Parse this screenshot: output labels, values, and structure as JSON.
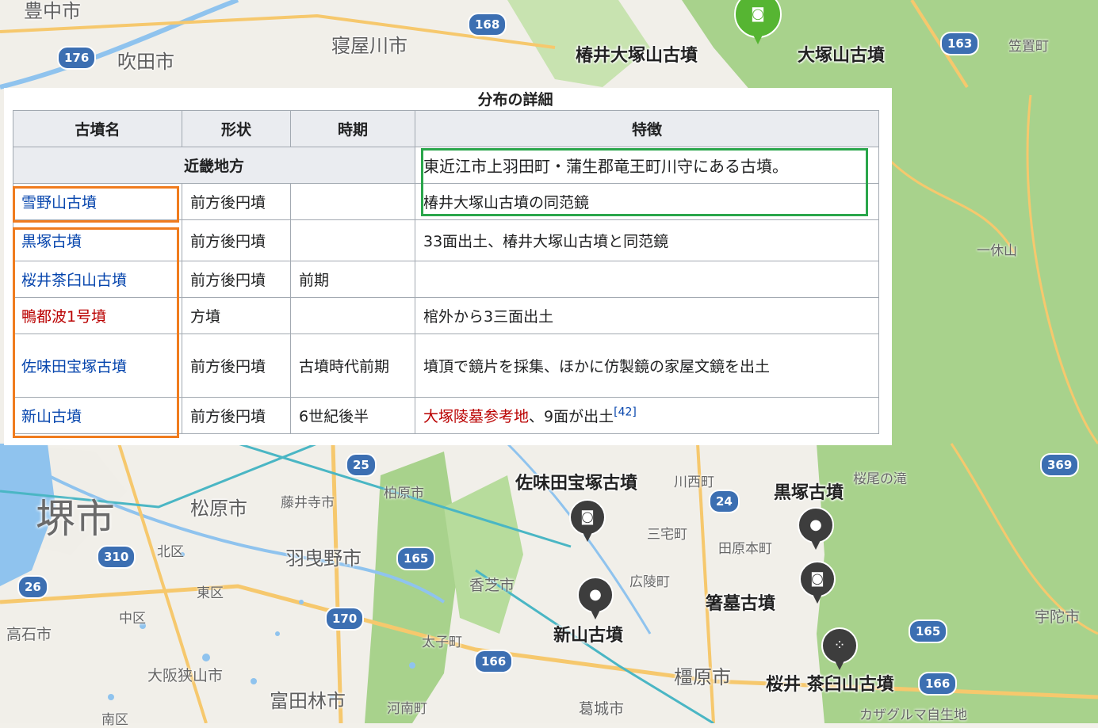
{
  "map": {
    "cities": [
      "吹田市",
      "寝屋川市",
      "松原市",
      "羽曳野市",
      "富田林市",
      "大阪狭山市",
      "橿原市",
      "堺市",
      "宇陀市",
      "香芝市",
      "葛城市",
      "高石市",
      "豊中市"
    ],
    "towns": [
      "笠置町",
      "一休山",
      "柏原市",
      "藤井寺市",
      "北区",
      "東区",
      "中区",
      "南区",
      "広陵町",
      "三宅町",
      "田原本町",
      "川西町",
      "太子町",
      "河南町",
      "桜尾の滝",
      "カザグルマ自生地"
    ],
    "routes": [
      "168",
      "176",
      "163",
      "25",
      "24",
      "369",
      "310",
      "165",
      "26",
      "170",
      "165",
      "166",
      "166"
    ],
    "pois": [
      "椿井大塚山古墳",
      "大塚山古墳",
      "佐味田宝塚古墳",
      "黒塚古墳",
      "箸墓古墳",
      "新山古墳",
      "桜井 茶臼山古墳"
    ],
    "icons": [
      "camera-icon",
      "dot-icon",
      "cluster-icon"
    ]
  },
  "table": {
    "caption": "分布の詳細",
    "headers": [
      "古墳名",
      "形状",
      "時期",
      "特徴"
    ],
    "region": "近畿地方",
    "region_note": "東近江市上羽田町・蒲生郡竜王町川守にある古墳。",
    "rows": [
      {
        "name": "雪野山古墳",
        "link": "blue",
        "shape": "前方後円墳",
        "period": "",
        "feature": "椿井大塚山古墳の同范鏡"
      },
      {
        "name": "黒塚古墳",
        "link": "blue",
        "shape": "前方後円墳",
        "period": "",
        "feature": "33面出土、椿井大塚山古墳と同范鏡"
      },
      {
        "name": "桜井茶臼山古墳",
        "link": "blue",
        "shape": "前方後円墳",
        "period": "前期",
        "feature": ""
      },
      {
        "name": "鴨都波1号墳",
        "link": "red",
        "shape": "方墳",
        "period": "",
        "feature": "棺外から3三面出土"
      },
      {
        "name": "佐味田宝塚古墳",
        "link": "blue",
        "shape": "前方後円墳",
        "period": "古墳時代前期",
        "feature": "墳頂で鏡片を採集、ほかに仿製鏡の家屋文鏡を出土"
      },
      {
        "name": "新山古墳",
        "link": "blue",
        "shape": "前方後円墳",
        "period": "6世紀後半",
        "feature_link": "大塚陵墓参考地",
        "feature": "、9面が出土",
        "ref": "[42]"
      }
    ]
  },
  "colors": {
    "orange": "#f07c1e",
    "green": "#2aa64b",
    "forest": "#a6d08a",
    "water": "#8fc3ee",
    "road": "#f6c86d"
  }
}
